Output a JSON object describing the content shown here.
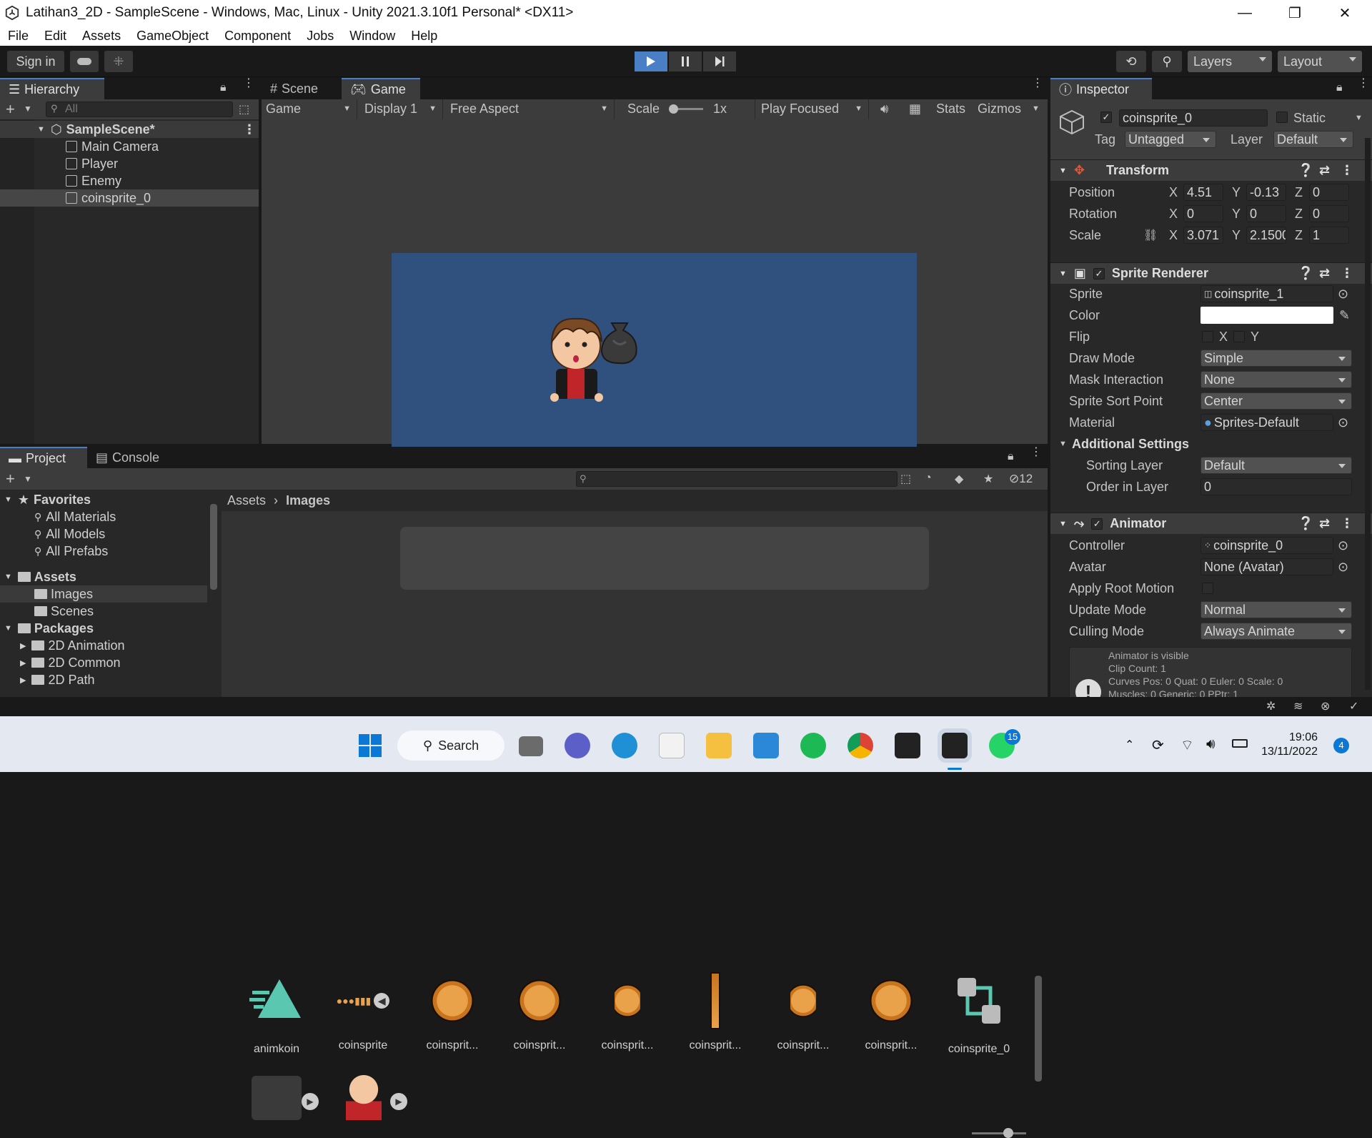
{
  "window": {
    "title": "Latihan3_2D - SampleScene - Windows, Mac, Linux - Unity 2021.3.10f1 Personal* <DX11>",
    "minimize": "—",
    "maximize": "❐",
    "close": "✕"
  },
  "menu": [
    "File",
    "Edit",
    "Assets",
    "GameObject",
    "Component",
    "Jobs",
    "Window",
    "Help"
  ],
  "toolbar": {
    "signin": "Sign in",
    "layers": "Layers",
    "layout": "Layout"
  },
  "hierarchy": {
    "tab": "Hierarchy",
    "search_placeholder": "All",
    "scene": "SampleScene*",
    "items": [
      "Main Camera",
      "Player",
      "Enemy",
      "coinsprite_0"
    ]
  },
  "game": {
    "tab_scene": "Scene",
    "tab_game": "Game",
    "view": "Game",
    "display": "Display 1",
    "aspect": "Free Aspect",
    "scale_label": "Scale",
    "scale_value": "1x",
    "play_focused": "Play Focused",
    "stats": "Stats",
    "gizmos": "Gizmos"
  },
  "inspector": {
    "tab": "Inspector",
    "name": "coinsprite_0",
    "static": "Static",
    "tag_label": "Tag",
    "tag": "Untagged",
    "layer_label": "Layer",
    "layer": "Default",
    "transform": {
      "title": "Transform",
      "position": "Position",
      "rotation": "Rotation",
      "scale": "Scale",
      "px": "4.51",
      "py": "-0.13",
      "pz": "0",
      "rx": "0",
      "ry": "0",
      "rz": "0",
      "sx": "3.071",
      "sy": "2.1500",
      "sz": "1",
      "x": "X",
      "y": "Y",
      "z": "Z"
    },
    "sprite_renderer": {
      "title": "Sprite Renderer",
      "sprite_label": "Sprite",
      "sprite": "coinsprite_1",
      "color_label": "Color",
      "flip_label": "Flip",
      "draw_mode_label": "Draw Mode",
      "draw_mode": "Simple",
      "mask_label": "Mask Interaction",
      "mask": "None",
      "sort_point_label": "Sprite Sort Point",
      "sort_point": "Center",
      "material_label": "Material",
      "material": "Sprites-Default",
      "additional": "Additional Settings",
      "sorting_layer_label": "Sorting Layer",
      "sorting_layer": "Default",
      "order_label": "Order in Layer",
      "order": "0"
    },
    "animator": {
      "title": "Animator",
      "controller_label": "Controller",
      "controller": "coinsprite_0",
      "avatar_label": "Avatar",
      "avatar": "None (Avatar)",
      "root_motion_label": "Apply Root Motion",
      "update_label": "Update Mode",
      "update": "Normal",
      "culling_label": "Culling Mode",
      "culling": "Always Animate",
      "info": [
        "Animator is visible",
        "Clip Count: 1",
        "Curves Pos: 0 Quat: 0 Euler: 0 Scale: 0",
        "Muscles: 0 Generic: 0 PPtr: 1"
      ]
    }
  },
  "project": {
    "tab_project": "Project",
    "tab_console": "Console",
    "hidden_count": "12",
    "favorites": "Favorites",
    "fav_items": [
      "All Materials",
      "All Models",
      "All Prefabs"
    ],
    "assets": "Assets",
    "asset_folders": [
      "Images",
      "Scenes"
    ],
    "packages": "Packages",
    "package_items": [
      "2D Animation",
      "2D Common",
      "2D Path"
    ],
    "breadcrumb_root": "Assets",
    "breadcrumb_leaf": "Images",
    "items": [
      "animkoin",
      "coinsprite",
      "coinsprit...",
      "coinsprit...",
      "coinsprit...",
      "coinsprit...",
      "coinsprit...",
      "coinsprit...",
      "coinsprite_0"
    ]
  },
  "taskbar": {
    "search": "Search",
    "time": "19:06",
    "date": "13/11/2022",
    "badge": "15",
    "notif": "4"
  },
  "colors": {
    "accent": "#4a7fc6",
    "game_bg": "#30507e",
    "play_active": "#4a7fc6"
  }
}
